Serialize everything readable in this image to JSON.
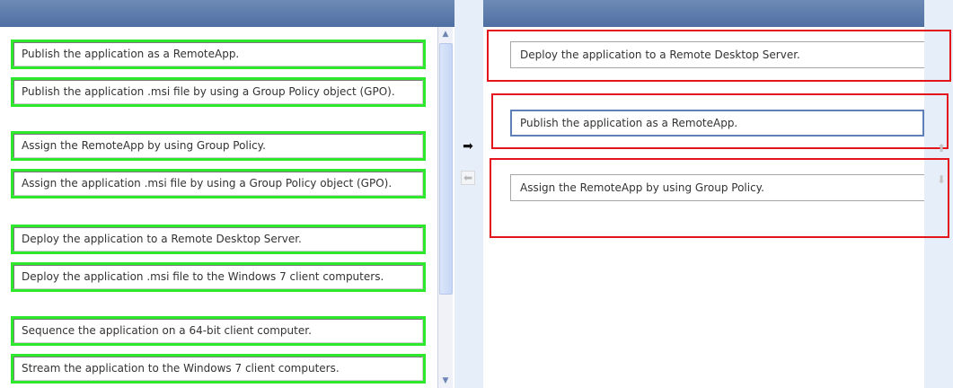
{
  "source_list": {
    "items": [
      {
        "label": "Publish the application as a RemoteApp."
      },
      {
        "label": "Publish the application .msi file by using a Group Policy object (GPO)."
      },
      {
        "label": "Assign the RemoteApp by using Group Policy."
      },
      {
        "label": "Assign the application .msi file by using a Group Policy object (GPO)."
      },
      {
        "label": "Deploy the application to a Remote Desktop Server."
      },
      {
        "label": "Deploy the application .msi file to the Windows 7 client computers."
      },
      {
        "label": "Sequence the application on a 64-bit client computer."
      },
      {
        "label": "Stream the application to the Windows 7 client computers."
      }
    ],
    "highlight_color": "#2de82d"
  },
  "controls": {
    "move_right_icon": "arrow-right-icon",
    "move_left_icon": "arrow-left-icon",
    "move_up_icon": "arrow-up-icon",
    "move_down_icon": "arrow-down-icon",
    "scroll_up_glyph": "▲",
    "scroll_down_glyph": "▼",
    "move_right_glyph": "➡",
    "move_left_glyph": "⬅",
    "move_up_glyph": "⬆",
    "move_down_glyph": "⬇"
  },
  "answer_area": {
    "slots": [
      {
        "label": "Deploy the application to a Remote Desktop Server."
      },
      {
        "label": "Publish the application as a RemoteApp."
      },
      {
        "label": "Assign the RemoteApp by using Group Policy."
      }
    ],
    "highlight_color": "#e3141b"
  },
  "theme": {
    "header_color": "#5a78ab",
    "side_strip_color": "#e6eef9"
  }
}
